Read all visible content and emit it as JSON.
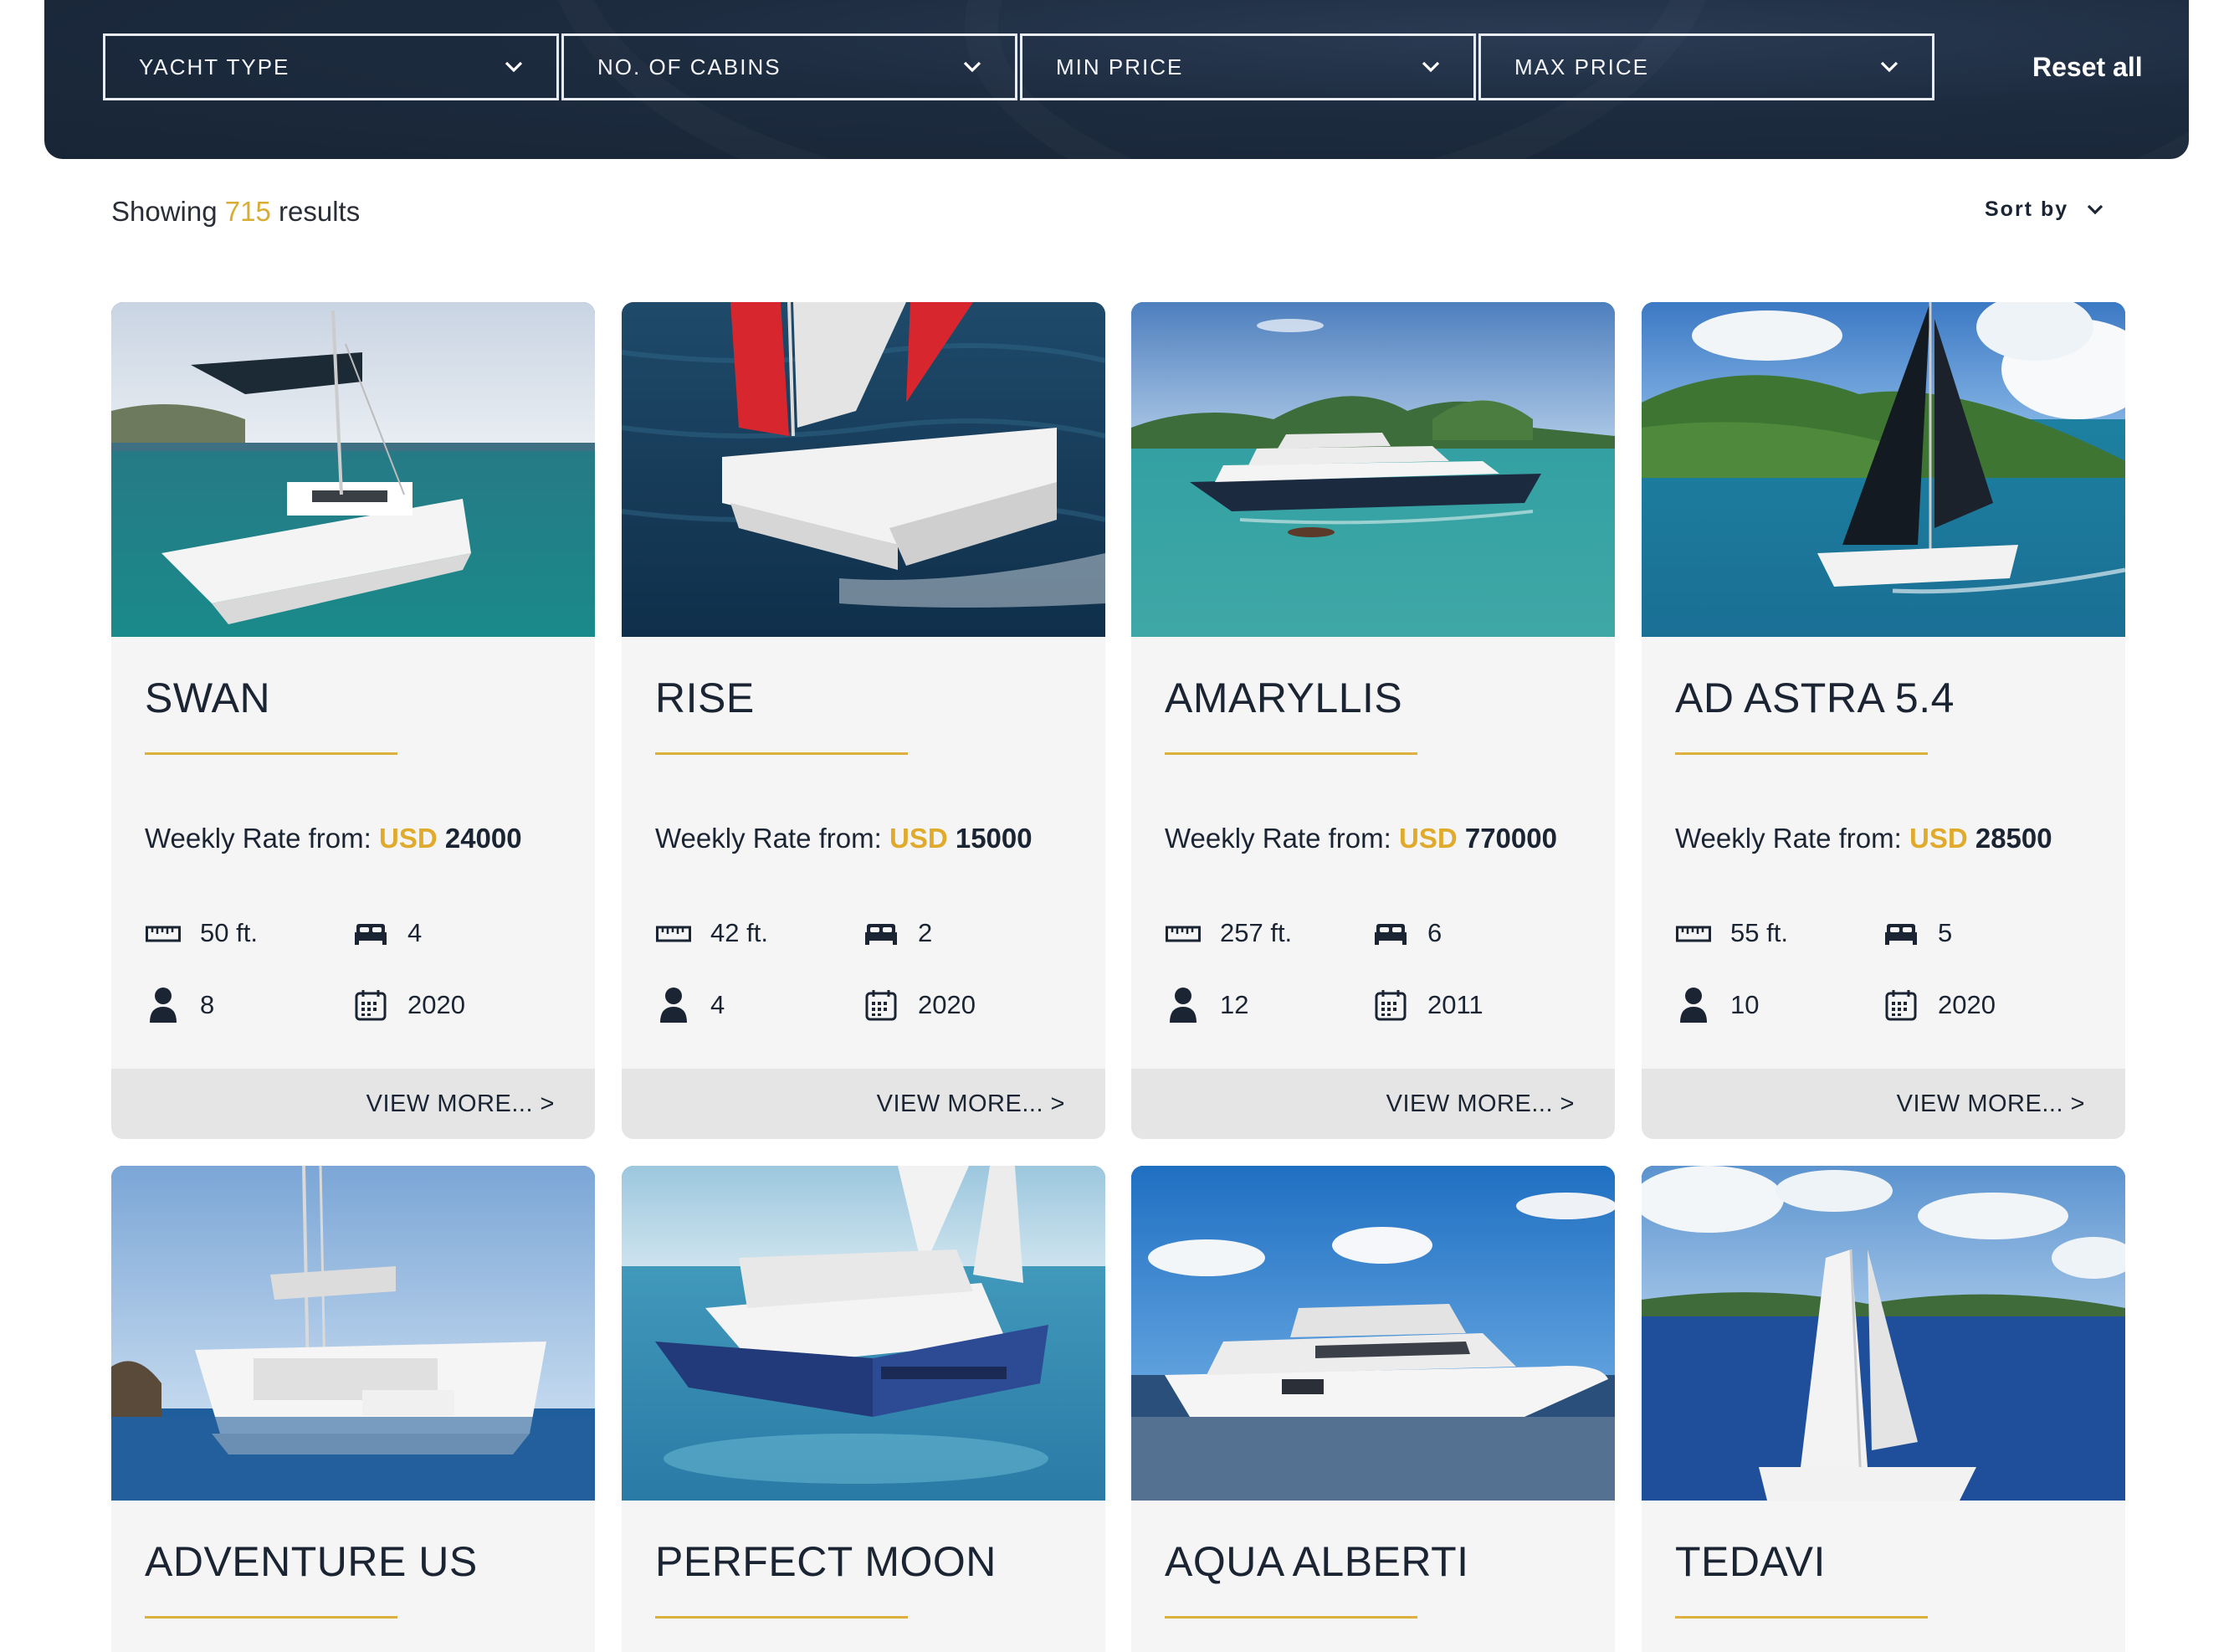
{
  "filters": [
    {
      "label": "YACHT TYPE"
    },
    {
      "label": "NO. OF CABINS"
    },
    {
      "label": "MIN PRICE"
    },
    {
      "label": "MAX PRICE"
    }
  ],
  "reset_label": "Reset all",
  "results": {
    "prefix": "Showing",
    "count": "715",
    "suffix": "results"
  },
  "sort_label": "Sort by",
  "card_labels": {
    "rate_prefix": "Weekly Rate from:",
    "currency": "USD",
    "view_more": "VIEW MORE... >"
  },
  "colors": {
    "navy": "#1d2b3f",
    "gold": "#dcb03c",
    "card_bg": "#f5f5f5",
    "button_bg": "#e5e5e5"
  },
  "yachts": [
    {
      "name": "SWAN",
      "rate": "24000",
      "length": "50 ft.",
      "cabins": "4",
      "guests": "8",
      "year": "2020"
    },
    {
      "name": "RISE",
      "rate": "15000",
      "length": "42 ft.",
      "cabins": "2",
      "guests": "4",
      "year": "2020"
    },
    {
      "name": "AMARYLLIS",
      "rate": "770000",
      "length": "257 ft.",
      "cabins": "6",
      "guests": "12",
      "year": "2011"
    },
    {
      "name": "AD ASTRA 5.4",
      "rate": "28500",
      "length": "55 ft.",
      "cabins": "5",
      "guests": "10",
      "year": "2020"
    },
    {
      "name": "ADVENTURE US"
    },
    {
      "name": "PERFECT MOON"
    },
    {
      "name": "AQUA ALBERTI"
    },
    {
      "name": "TEDAVI"
    }
  ],
  "icons": {
    "length": "ruler-icon",
    "cabins": "bed-icon",
    "guests": "person-icon",
    "year": "calendar-icon",
    "dropdown": "chevron-down-icon"
  }
}
